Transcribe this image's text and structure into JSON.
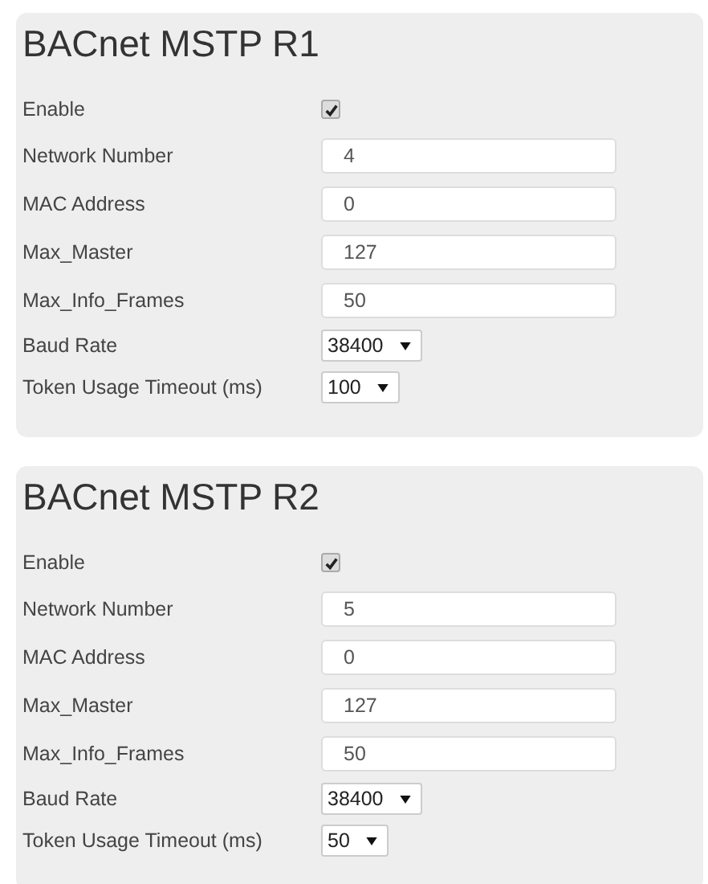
{
  "panels": [
    {
      "title": "BACnet MSTP R1",
      "fields": [
        {
          "label": "Enable",
          "kind": "checkbox",
          "checked": true
        },
        {
          "label": "Network Number",
          "kind": "text",
          "value": "4"
        },
        {
          "label": "MAC Address",
          "kind": "text",
          "value": "0"
        },
        {
          "label": "Max_Master",
          "kind": "text",
          "value": "127"
        },
        {
          "label": "Max_Info_Frames",
          "kind": "text",
          "value": "50"
        },
        {
          "label": "Baud Rate",
          "kind": "select",
          "value": "38400"
        },
        {
          "label": "Token Usage Timeout (ms)",
          "kind": "select",
          "value": "100"
        }
      ]
    },
    {
      "title": "BACnet MSTP R2",
      "fields": [
        {
          "label": "Enable",
          "kind": "checkbox",
          "checked": true
        },
        {
          "label": "Network Number",
          "kind": "text",
          "value": "5"
        },
        {
          "label": "MAC Address",
          "kind": "text",
          "value": "0"
        },
        {
          "label": "Max_Master",
          "kind": "text",
          "value": "127"
        },
        {
          "label": "Max_Info_Frames",
          "kind": "text",
          "value": "50"
        },
        {
          "label": "Baud Rate",
          "kind": "select",
          "value": "38400"
        },
        {
          "label": "Token Usage Timeout (ms)",
          "kind": "select",
          "value": "50"
        }
      ]
    }
  ]
}
